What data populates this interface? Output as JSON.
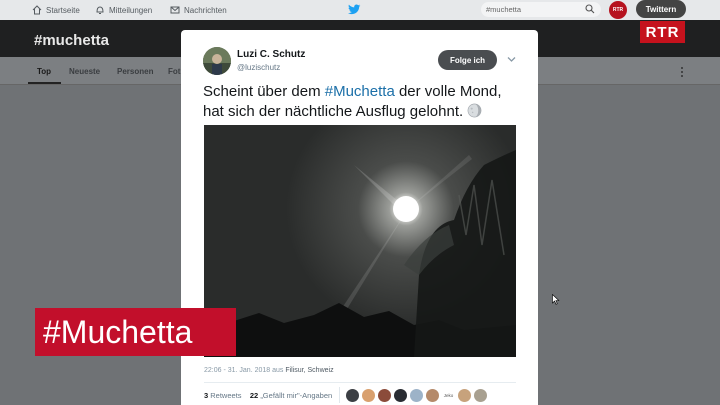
{
  "topnav": {
    "home_label": "Startseite",
    "notifications_label": "Mitteilungen",
    "messages_label": "Nachrichten",
    "search_value": "#muchetta",
    "profile_avatar_text": "RTR",
    "tweet_button_label": "Twittern"
  },
  "header": {
    "title": "#muchetta",
    "broadcaster_logo": "RTR"
  },
  "tabs": [
    {
      "label": "Top",
      "active": true
    },
    {
      "label": "Neueste"
    },
    {
      "label": "Personen"
    },
    {
      "label": "Fot"
    }
  ],
  "tweet": {
    "author_name": "Luzi C. Schutz",
    "author_handle": "@luzischutz",
    "follow_label": "Folge ich",
    "text_before": "Scheint über dem ",
    "hashtag": "#Muchetta",
    "text_after": " der volle Mond, hat sich der nächtliche Ausflug gelohnt.",
    "emoji": "moon-icon",
    "timestamp": "22:06 - 31. Jan. 2018 aus ",
    "location": "Filisur, Schweiz",
    "retweets_count": "3",
    "retweets_label": "Retweets",
    "likes_count": "22",
    "likes_label": "„Gefällt mir\"-Angaben",
    "liker_text": "Jeko"
  },
  "overlay": {
    "title": "#Muchetta"
  },
  "colors": {
    "accent_red": "#c20f2b",
    "link_blue": "#1b6fa8",
    "twitter_blue": "#1da1f2"
  }
}
